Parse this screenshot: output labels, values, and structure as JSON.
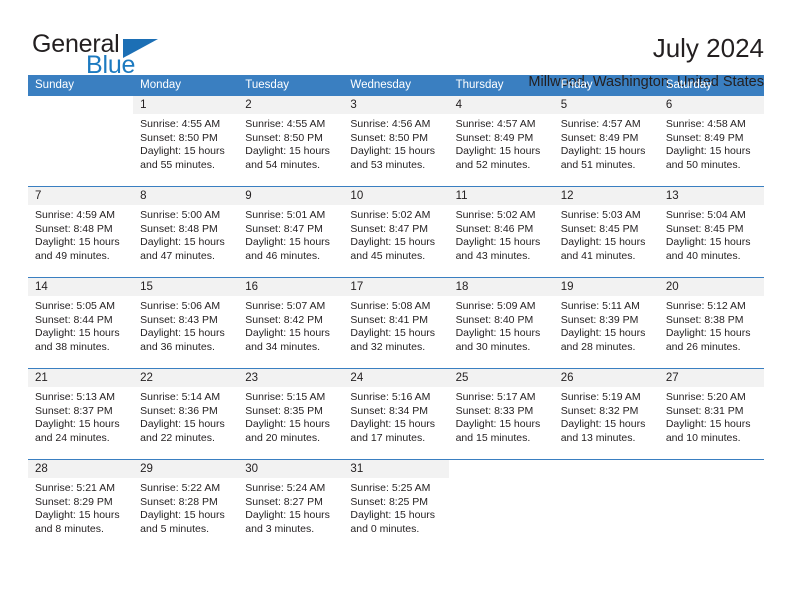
{
  "brand": {
    "name_dark": "General",
    "name_blue": "Blue",
    "accent_color": "#1c7ac0",
    "header_color": "#3a7fc1"
  },
  "header": {
    "title": "July 2024",
    "subtitle": "Millwood, Washington, United States"
  },
  "calendar": {
    "weekday_headers": [
      "Sunday",
      "Monday",
      "Tuesday",
      "Wednesday",
      "Thursday",
      "Friday",
      "Saturday"
    ],
    "weeks": [
      [
        {
          "day": "",
          "sunrise": "",
          "sunset": "",
          "daylight1": "",
          "daylight2": "",
          "blank": true
        },
        {
          "day": "1",
          "sunrise": "Sunrise: 4:55 AM",
          "sunset": "Sunset: 8:50 PM",
          "daylight1": "Daylight: 15 hours",
          "daylight2": "and 55 minutes."
        },
        {
          "day": "2",
          "sunrise": "Sunrise: 4:55 AM",
          "sunset": "Sunset: 8:50 PM",
          "daylight1": "Daylight: 15 hours",
          "daylight2": "and 54 minutes."
        },
        {
          "day": "3",
          "sunrise": "Sunrise: 4:56 AM",
          "sunset": "Sunset: 8:50 PM",
          "daylight1": "Daylight: 15 hours",
          "daylight2": "and 53 minutes."
        },
        {
          "day": "4",
          "sunrise": "Sunrise: 4:57 AM",
          "sunset": "Sunset: 8:49 PM",
          "daylight1": "Daylight: 15 hours",
          "daylight2": "and 52 minutes."
        },
        {
          "day": "5",
          "sunrise": "Sunrise: 4:57 AM",
          "sunset": "Sunset: 8:49 PM",
          "daylight1": "Daylight: 15 hours",
          "daylight2": "and 51 minutes."
        },
        {
          "day": "6",
          "sunrise": "Sunrise: 4:58 AM",
          "sunset": "Sunset: 8:49 PM",
          "daylight1": "Daylight: 15 hours",
          "daylight2": "and 50 minutes."
        }
      ],
      [
        {
          "day": "7",
          "sunrise": "Sunrise: 4:59 AM",
          "sunset": "Sunset: 8:48 PM",
          "daylight1": "Daylight: 15 hours",
          "daylight2": "and 49 minutes."
        },
        {
          "day": "8",
          "sunrise": "Sunrise: 5:00 AM",
          "sunset": "Sunset: 8:48 PM",
          "daylight1": "Daylight: 15 hours",
          "daylight2": "and 47 minutes."
        },
        {
          "day": "9",
          "sunrise": "Sunrise: 5:01 AM",
          "sunset": "Sunset: 8:47 PM",
          "daylight1": "Daylight: 15 hours",
          "daylight2": "and 46 minutes."
        },
        {
          "day": "10",
          "sunrise": "Sunrise: 5:02 AM",
          "sunset": "Sunset: 8:47 PM",
          "daylight1": "Daylight: 15 hours",
          "daylight2": "and 45 minutes."
        },
        {
          "day": "11",
          "sunrise": "Sunrise: 5:02 AM",
          "sunset": "Sunset: 8:46 PM",
          "daylight1": "Daylight: 15 hours",
          "daylight2": "and 43 minutes."
        },
        {
          "day": "12",
          "sunrise": "Sunrise: 5:03 AM",
          "sunset": "Sunset: 8:45 PM",
          "daylight1": "Daylight: 15 hours",
          "daylight2": "and 41 minutes."
        },
        {
          "day": "13",
          "sunrise": "Sunrise: 5:04 AM",
          "sunset": "Sunset: 8:45 PM",
          "daylight1": "Daylight: 15 hours",
          "daylight2": "and 40 minutes."
        }
      ],
      [
        {
          "day": "14",
          "sunrise": "Sunrise: 5:05 AM",
          "sunset": "Sunset: 8:44 PM",
          "daylight1": "Daylight: 15 hours",
          "daylight2": "and 38 minutes."
        },
        {
          "day": "15",
          "sunrise": "Sunrise: 5:06 AM",
          "sunset": "Sunset: 8:43 PM",
          "daylight1": "Daylight: 15 hours",
          "daylight2": "and 36 minutes."
        },
        {
          "day": "16",
          "sunrise": "Sunrise: 5:07 AM",
          "sunset": "Sunset: 8:42 PM",
          "daylight1": "Daylight: 15 hours",
          "daylight2": "and 34 minutes."
        },
        {
          "day": "17",
          "sunrise": "Sunrise: 5:08 AM",
          "sunset": "Sunset: 8:41 PM",
          "daylight1": "Daylight: 15 hours",
          "daylight2": "and 32 minutes."
        },
        {
          "day": "18",
          "sunrise": "Sunrise: 5:09 AM",
          "sunset": "Sunset: 8:40 PM",
          "daylight1": "Daylight: 15 hours",
          "daylight2": "and 30 minutes."
        },
        {
          "day": "19",
          "sunrise": "Sunrise: 5:11 AM",
          "sunset": "Sunset: 8:39 PM",
          "daylight1": "Daylight: 15 hours",
          "daylight2": "and 28 minutes."
        },
        {
          "day": "20",
          "sunrise": "Sunrise: 5:12 AM",
          "sunset": "Sunset: 8:38 PM",
          "daylight1": "Daylight: 15 hours",
          "daylight2": "and 26 minutes."
        }
      ],
      [
        {
          "day": "21",
          "sunrise": "Sunrise: 5:13 AM",
          "sunset": "Sunset: 8:37 PM",
          "daylight1": "Daylight: 15 hours",
          "daylight2": "and 24 minutes."
        },
        {
          "day": "22",
          "sunrise": "Sunrise: 5:14 AM",
          "sunset": "Sunset: 8:36 PM",
          "daylight1": "Daylight: 15 hours",
          "daylight2": "and 22 minutes."
        },
        {
          "day": "23",
          "sunrise": "Sunrise: 5:15 AM",
          "sunset": "Sunset: 8:35 PM",
          "daylight1": "Daylight: 15 hours",
          "daylight2": "and 20 minutes."
        },
        {
          "day": "24",
          "sunrise": "Sunrise: 5:16 AM",
          "sunset": "Sunset: 8:34 PM",
          "daylight1": "Daylight: 15 hours",
          "daylight2": "and 17 minutes."
        },
        {
          "day": "25",
          "sunrise": "Sunrise: 5:17 AM",
          "sunset": "Sunset: 8:33 PM",
          "daylight1": "Daylight: 15 hours",
          "daylight2": "and 15 minutes."
        },
        {
          "day": "26",
          "sunrise": "Sunrise: 5:19 AM",
          "sunset": "Sunset: 8:32 PM",
          "daylight1": "Daylight: 15 hours",
          "daylight2": "and 13 minutes."
        },
        {
          "day": "27",
          "sunrise": "Sunrise: 5:20 AM",
          "sunset": "Sunset: 8:31 PM",
          "daylight1": "Daylight: 15 hours",
          "daylight2": "and 10 minutes."
        }
      ],
      [
        {
          "day": "28",
          "sunrise": "Sunrise: 5:21 AM",
          "sunset": "Sunset: 8:29 PM",
          "daylight1": "Daylight: 15 hours",
          "daylight2": "and 8 minutes."
        },
        {
          "day": "29",
          "sunrise": "Sunrise: 5:22 AM",
          "sunset": "Sunset: 8:28 PM",
          "daylight1": "Daylight: 15 hours",
          "daylight2": "and 5 minutes."
        },
        {
          "day": "30",
          "sunrise": "Sunrise: 5:24 AM",
          "sunset": "Sunset: 8:27 PM",
          "daylight1": "Daylight: 15 hours",
          "daylight2": "and 3 minutes."
        },
        {
          "day": "31",
          "sunrise": "Sunrise: 5:25 AM",
          "sunset": "Sunset: 8:25 PM",
          "daylight1": "Daylight: 15 hours",
          "daylight2": "and 0 minutes."
        },
        {
          "day": "",
          "sunrise": "",
          "sunset": "",
          "daylight1": "",
          "daylight2": "",
          "blank": true
        },
        {
          "day": "",
          "sunrise": "",
          "sunset": "",
          "daylight1": "",
          "daylight2": "",
          "blank": true
        },
        {
          "day": "",
          "sunrise": "",
          "sunset": "",
          "daylight1": "",
          "daylight2": "",
          "blank": true
        }
      ]
    ]
  }
}
